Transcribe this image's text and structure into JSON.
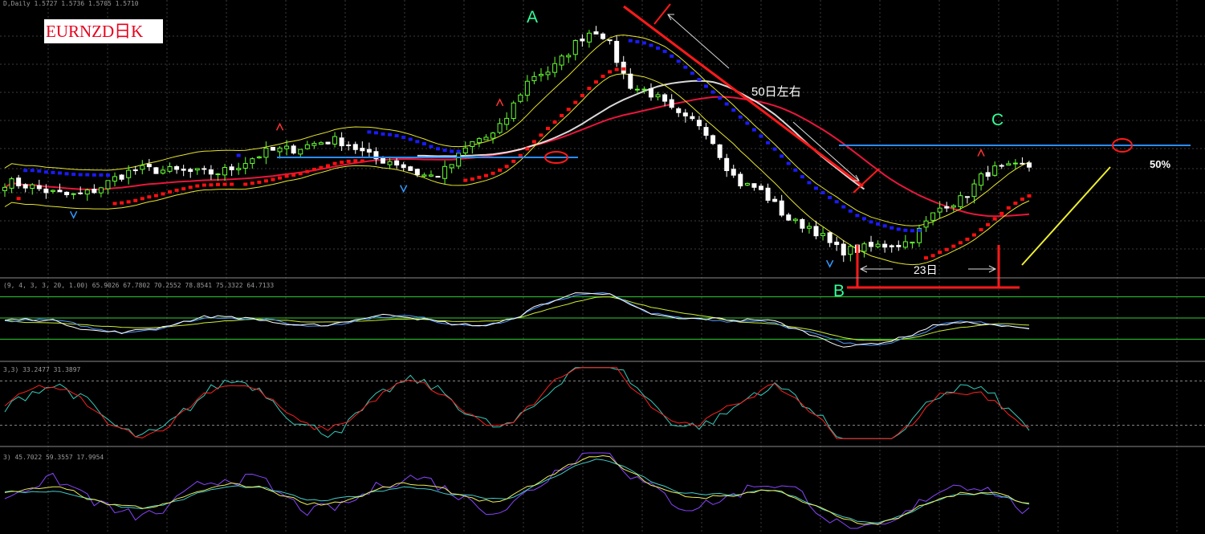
{
  "header": {
    "main_info": "D,Daily  1.5727 1.5736 1.5705 1.5710",
    "ind1_info": "(9, 4, 3, 3, 20, 1.00) 65.9026 67.7802 70.2552 78.8541 75.3322 64.7133",
    "ind2_info": "3,3) 33.2477 31.3897",
    "ind3_info": "3) 45.7022 59.3557 17.9954"
  },
  "title": "EURNZD日K",
  "annotations": {
    "point_a": "A",
    "point_b": "B",
    "point_c": "C",
    "duration_50": "50日左右",
    "duration_23": "23日",
    "retrace": "50%"
  },
  "colors": {
    "background": "#000000",
    "grid": "#3c3c3c",
    "candle_up": "#66ff33",
    "candle_down": "#ffffff",
    "sar_up": "#ff1010",
    "sar_down": "#1a1aff",
    "ma_long": "#e8163c",
    "envelope": "#e6e62e",
    "ma_white": "#ffffff",
    "level_line": "#2a8cff",
    "annotation_red": "#ff1a1a",
    "label_green": "#33ff99",
    "osc_white": "#ffffff",
    "osc_blue": "#5599ff",
    "osc_yellow": "#ccee33",
    "osc_green": "#33cc33",
    "stoch_red": "#ff2020",
    "stoch_cyan": "#33ccbb",
    "ind3_purple": "#8844ff",
    "ind3_yellow": "#eeee55",
    "ind3_cyan": "#44cccc",
    "fractal_up": "#ff3333",
    "fractal_down": "#3399ff"
  },
  "chart_data": {
    "type": "candlestick",
    "title": "EURNZD日K",
    "n_bars": 150,
    "anchors": {
      "bar_index": [
        0,
        10,
        20,
        30,
        40,
        48,
        55,
        62,
        70,
        78,
        86,
        92,
        100,
        108,
        116,
        122,
        130,
        138,
        144,
        149
      ],
      "close": [
        1.566,
        1.562,
        1.57,
        1.569,
        1.576,
        1.579,
        1.573,
        1.568,
        1.58,
        1.6,
        1.613,
        1.595,
        1.585,
        1.565,
        1.553,
        1.545,
        1.547,
        1.56,
        1.57,
        1.571
      ]
    },
    "key_points": {
      "A": {
        "bar": 72,
        "price": 1.615
      },
      "B": {
        "bar": 120,
        "price": 1.542
      },
      "C": {
        "bar": 142,
        "price": 1.568
      }
    },
    "level_line": 1.568,
    "indicator_1": {
      "levels": [
        80,
        50,
        20
      ]
    },
    "indicator_2": {
      "levels": [
        80,
        20
      ]
    }
  }
}
